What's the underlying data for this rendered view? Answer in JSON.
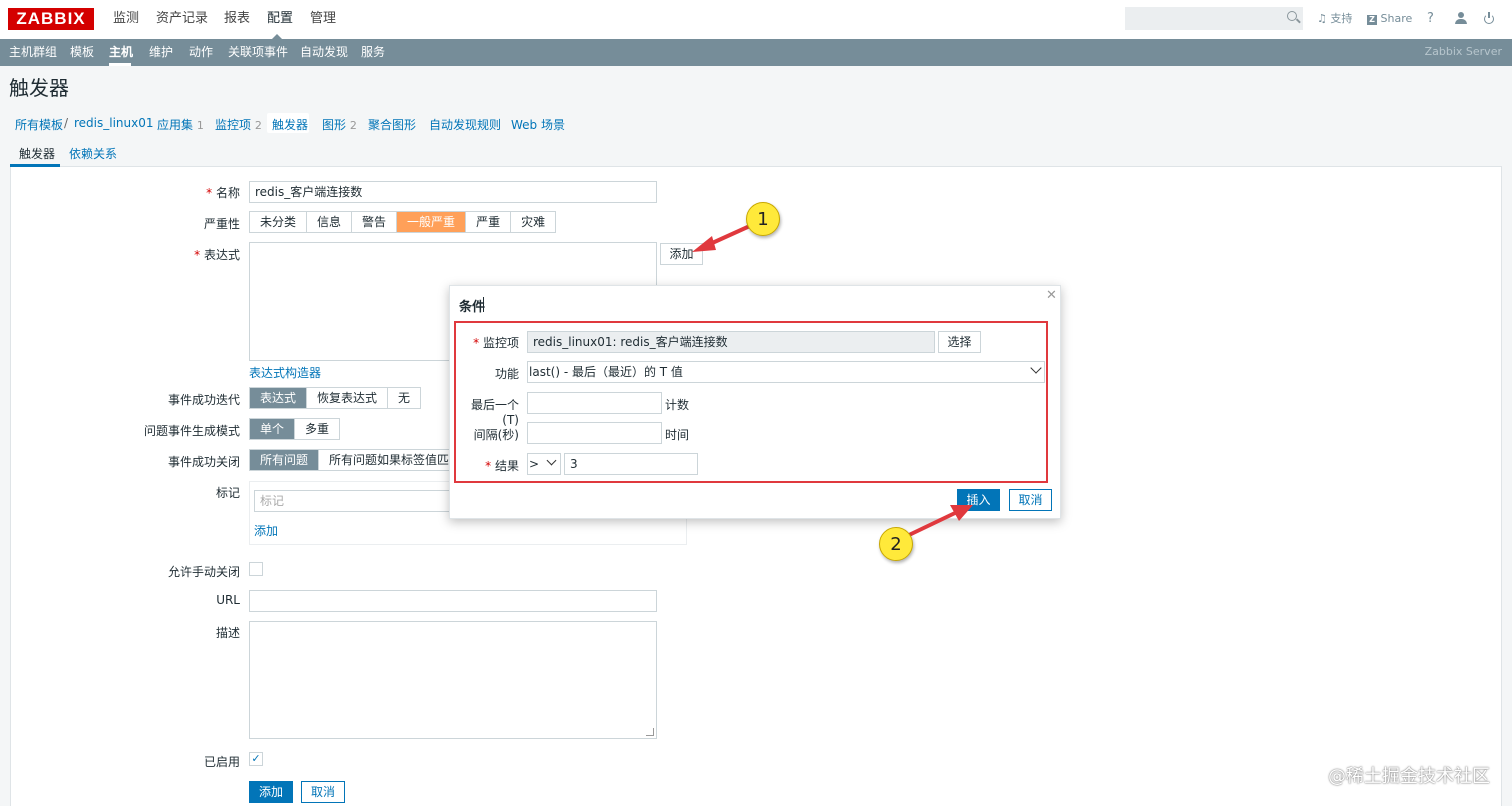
{
  "header": {
    "logo": "ZABBIX",
    "menu": [
      "监测",
      "资产记录",
      "报表",
      "配置",
      "管理"
    ],
    "search_placeholder": "",
    "support": "支持",
    "share": "Share",
    "help": "?",
    "user_icon": "user-icon"
  },
  "submenu": {
    "items": [
      "主机群组",
      "模板",
      "主机",
      "维护",
      "动作",
      "关联项事件",
      "自动发现",
      "服务"
    ],
    "server": "Zabbix Server"
  },
  "page": {
    "title": "触发器"
  },
  "breadcrumb": {
    "all_templates": "所有模板",
    "sep": "/",
    "host": "redis_linux01",
    "applications": "应用集",
    "applications_count": "1",
    "items": "监控项",
    "items_count": "2",
    "triggers": "触发器",
    "graphs": "图形",
    "graphs_count": "2",
    "screens": "聚合图形",
    "discovery": "自动发现规则",
    "web": "Web 场景"
  },
  "tabs": [
    "触发器",
    "依赖关系"
  ],
  "form": {
    "name_label": "名称",
    "name_value": "redis_客户端连接数",
    "severity_label": "严重性",
    "severity": [
      "未分类",
      "信息",
      "警告",
      "一般严重",
      "严重",
      "灾难"
    ],
    "severity_selected": "一般严重",
    "expression_label": "表达式",
    "add_button": "添加",
    "expr_builder": "表达式构造器",
    "ok_event_label": "事件成功迭代",
    "ok_event": [
      "表达式",
      "恢复表达式",
      "无"
    ],
    "mode_label": "问题事件生成模式",
    "mode": [
      "单个",
      "多重"
    ],
    "close_label": "事件成功关闭",
    "close": [
      "所有问题",
      "所有问题如果标签值匹配"
    ],
    "tags_label": "标记",
    "tag_placeholder": "标记",
    "tag_add": "添加",
    "manual_close_label": "允许手动关闭",
    "url_label": "URL",
    "desc_label": "描述",
    "enabled_label": "已启用",
    "submit": "添加",
    "cancel": "取消"
  },
  "dialog": {
    "title": "条件",
    "item_label": "监控项",
    "item_value": "redis_linux01: redis_客户端连接数",
    "select_button": "选择",
    "function_label": "功能",
    "function_value": "last() - 最后（最近）的 T 值",
    "last_label": "最后一个 (T)",
    "last_suffix": "计数",
    "interval_label": "间隔(秒)",
    "interval_suffix": "时间",
    "result_label": "结果",
    "result_op": ">",
    "result_value": "3",
    "insert": "插入",
    "cancel": "取消"
  },
  "annotations": {
    "badge1": "1",
    "badge2": "2"
  },
  "watermark": "@稀土掘金技术社区",
  "colors": {
    "brand": "#d40000",
    "nav": "#768d99",
    "link": "#0275b8",
    "severity_average": "#ffa059",
    "highlight": "#e0393e"
  }
}
